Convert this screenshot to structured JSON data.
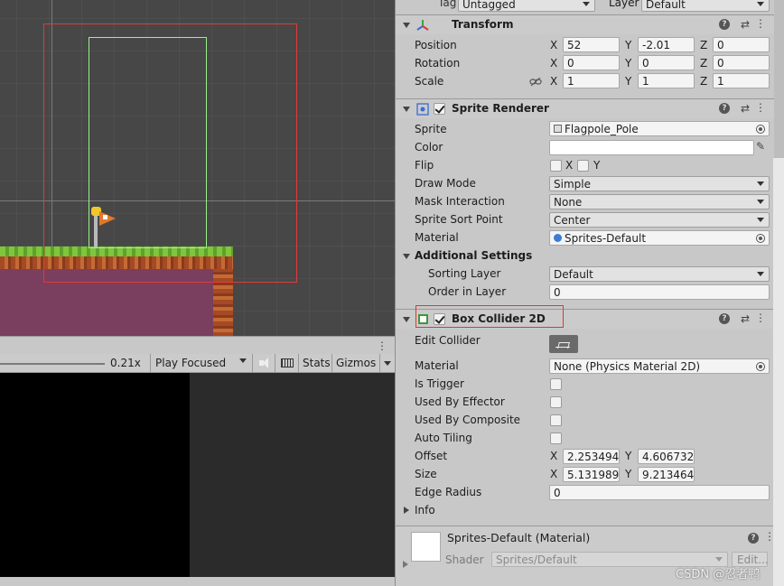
{
  "top_partial": {
    "tag_value": "Untagged",
    "layer_label": "Layer",
    "layer_value": "Default"
  },
  "transform": {
    "title": "Transform",
    "position": {
      "label": "Position",
      "x": "52",
      "y": "-2.01",
      "z": "0"
    },
    "rotation": {
      "label": "Rotation",
      "x": "0",
      "y": "0",
      "z": "0"
    },
    "scale": {
      "label": "Scale",
      "x": "1",
      "y": "1",
      "z": "1"
    }
  },
  "axes": {
    "x": "X",
    "y": "Y",
    "z": "Z"
  },
  "sprite_renderer": {
    "title": "Sprite Renderer",
    "sprite": {
      "label": "Sprite",
      "value": "Flagpole_Pole"
    },
    "color": {
      "label": "Color",
      "value": "#FFFFFF"
    },
    "flip": {
      "label": "Flip",
      "x": "X",
      "y": "Y"
    },
    "draw_mode": {
      "label": "Draw Mode",
      "value": "Simple"
    },
    "mask_interaction": {
      "label": "Mask Interaction",
      "value": "None"
    },
    "sprite_sort_point": {
      "label": "Sprite Sort Point",
      "value": "Center"
    },
    "material": {
      "label": "Material",
      "value": "Sprites-Default"
    },
    "additional_settings": "Additional Settings",
    "sorting_layer": {
      "label": "Sorting Layer",
      "value": "Default"
    },
    "order_in_layer": {
      "label": "Order in Layer",
      "value": "0"
    }
  },
  "box_collider": {
    "title": "Box Collider 2D",
    "edit_collider": "Edit Collider",
    "material": {
      "label": "Material",
      "value": "None (Physics Material 2D)"
    },
    "is_trigger": "Is Trigger",
    "used_by_effector": "Used By Effector",
    "used_by_composite": "Used By Composite",
    "auto_tiling": "Auto Tiling",
    "offset": {
      "label": "Offset",
      "x": "2.253494",
      "y": "4.606732"
    },
    "size": {
      "label": "Size",
      "x": "5.131989",
      "y": "9.213464"
    },
    "edge_radius": {
      "label": "Edge Radius",
      "value": "0"
    },
    "info": "Info"
  },
  "material_footer": {
    "title": "Sprites-Default (Material)",
    "shader_label": "Shader",
    "shader_value": "Sprites/Default",
    "edit_label": "Edit..."
  },
  "game_toolbar": {
    "scale_value": "0.21x",
    "play_mode": "Play Focused",
    "stats": "Stats",
    "gizmos": "Gizmos"
  },
  "watermark": "CSDN @忍者鸭",
  "colors": {
    "selection": "#e03a3a",
    "collider": "#9ef08a",
    "panel": "#c8c8c8"
  }
}
